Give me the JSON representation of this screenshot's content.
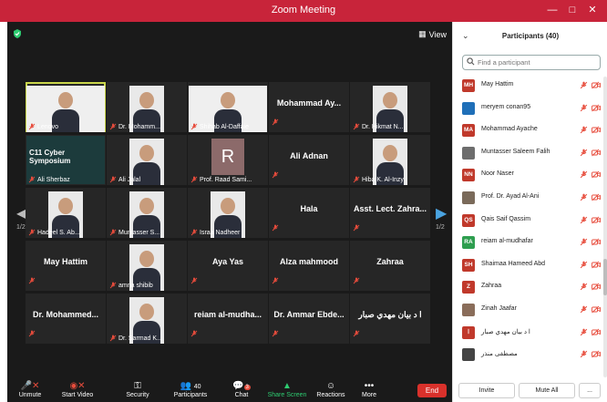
{
  "window": {
    "title": "Zoom Meeting"
  },
  "video": {
    "view_label": "View",
    "page_left": "1/2",
    "page_right": "1/2",
    "tiles": [
      {
        "label": "Lenovo",
        "kind": "video"
      },
      {
        "label": "Dr. Mohamm...",
        "kind": "video"
      },
      {
        "label": "Shihab Al-Daffaie",
        "kind": "video"
      },
      {
        "label": "Mohammad Ay...",
        "kind": "name"
      },
      {
        "label": "Dr. Hikmat N...",
        "kind": "video"
      },
      {
        "label": "Ali Sherbaz",
        "kind": "slide",
        "slide_text": "C11 Cyber\nSymposium"
      },
      {
        "label": "Ali Jalal",
        "kind": "video"
      },
      {
        "label": "Prof. Raad Sami...",
        "kind": "letter",
        "letter": "R"
      },
      {
        "label": "Ali Adnan",
        "kind": "name"
      },
      {
        "label": "Hiba K. Al-Inzy",
        "kind": "video"
      },
      {
        "label": "Hadeel S. Ab...",
        "kind": "video"
      },
      {
        "label": "Muntasser S...",
        "kind": "video"
      },
      {
        "label": "Israa Nadheer",
        "kind": "video"
      },
      {
        "label": "Hala",
        "kind": "name"
      },
      {
        "label": "Asst. Lect. Zahra...",
        "kind": "name"
      },
      {
        "label": "May Hattim",
        "kind": "name"
      },
      {
        "label": "amna shibib",
        "kind": "video"
      },
      {
        "label": "Aya Yas",
        "kind": "name"
      },
      {
        "label": "Alza mahmood",
        "kind": "name"
      },
      {
        "label": "Zahraa",
        "kind": "name"
      },
      {
        "label": "Dr. Mohammed...",
        "kind": "name"
      },
      {
        "label": "Dr. Sarmad K...",
        "kind": "video"
      },
      {
        "label": "reiam  al-mudha...",
        "kind": "name"
      },
      {
        "label": "Dr. Ammar Ebde...",
        "kind": "name"
      },
      {
        "label": "ا د بيان مهدي صبار",
        "kind": "name"
      }
    ]
  },
  "toolbar": {
    "unmute": "Unmute",
    "start_video": "Start Video",
    "security": "Security",
    "participants": "Participants",
    "participants_count": "40",
    "chat": "Chat",
    "chat_badge": "3",
    "share_screen": "Share Screen",
    "reactions": "Reactions",
    "more": "More",
    "end": "End"
  },
  "panel": {
    "title": "Participants (40)",
    "search_placeholder": "Find a participant",
    "invite": "Invite",
    "mute_all": "Mute All",
    "more": "...",
    "participants": [
      {
        "name": "May Hattim",
        "initials": "MH",
        "color": "#c0392b"
      },
      {
        "name": "meryem conan95",
        "initials": "",
        "color": "#1f6fb8"
      },
      {
        "name": "Mohammad Ayache",
        "initials": "MA",
        "color": "#c0392b"
      },
      {
        "name": "Muntasser Saleem Falih",
        "initials": "",
        "color": "#6d6d6d"
      },
      {
        "name": "Noor Naser",
        "initials": "NN",
        "color": "#c0392b"
      },
      {
        "name": "Prof. Dr. Ayad Al-Ani",
        "initials": "",
        "color": "#7a6a5a"
      },
      {
        "name": "Qais Saif Qassim",
        "initials": "QS",
        "color": "#c0392b"
      },
      {
        "name": "reiam al-mudhafar",
        "initials": "RA",
        "color": "#2e9e4f"
      },
      {
        "name": "Shaimaa Hameed Abd",
        "initials": "SH",
        "color": "#c0392b"
      },
      {
        "name": "Zahraa",
        "initials": "Z",
        "color": "#c0392b"
      },
      {
        "name": "Zinah Jaafar",
        "initials": "",
        "color": "#8a6d5a"
      },
      {
        "name": "ا د بيان مهدي صبار",
        "initials": "ا",
        "color": "#c0392b"
      },
      {
        "name": "مصطفى منذر",
        "initials": "",
        "color": "#444444"
      }
    ]
  }
}
